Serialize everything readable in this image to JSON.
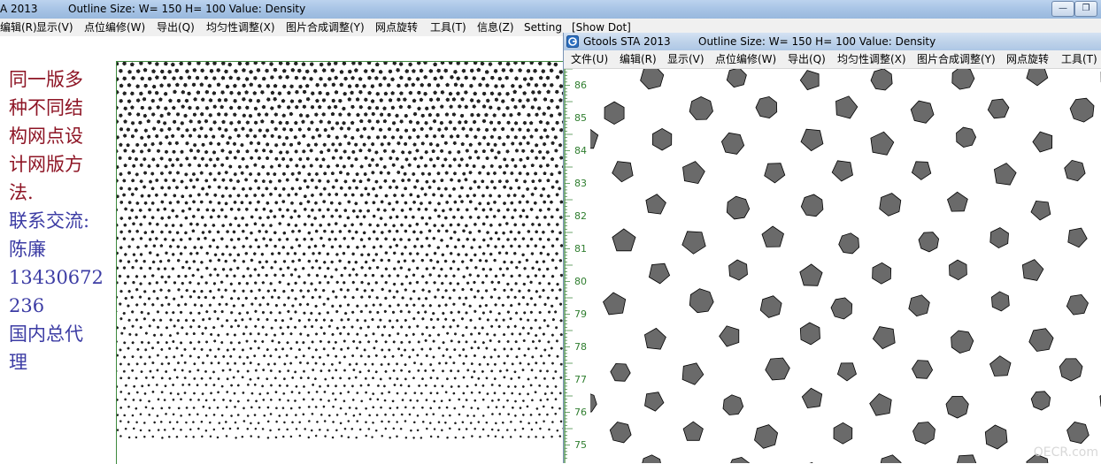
{
  "back_window": {
    "title": "A 2013",
    "title_info": "Outline Size: W= 150  H= 100  Value: Density",
    "buttons": {
      "minimize": "—",
      "restore": "❐"
    },
    "menu": [
      "编辑(R)",
      "显示(V)",
      "点位编修(W)",
      "导出(Q)",
      "均匀性调整(X)",
      "图片合成调整(Y)",
      "网点旋转",
      "工具(T)",
      "信息(Z)",
      "Setting",
      "[Show Dot]"
    ]
  },
  "side_text": {
    "lines_red": [
      "同一版多",
      "种不同结",
      "构网点设",
      "计网版方",
      "法."
    ],
    "lines_blue": [
      "联系交流:",
      "陈廉",
      "13430672",
      "236",
      "国内总代",
      "理"
    ]
  },
  "front_window": {
    "title": "Gtools STA 2013",
    "title_info": "Outline Size: W= 150  H= 100  Value: Density",
    "menu": [
      "文件(U)",
      "编辑(R)",
      "显示(V)",
      "点位编修(W)",
      "导出(Q)",
      "均匀性调整(X)",
      "图片合成调整(Y)",
      "网点旋转",
      "工具(T)"
    ]
  },
  "ruler_labels": [
    "86",
    "85",
    "84",
    "83",
    "82",
    "81",
    "80",
    "79",
    "78",
    "77",
    "76",
    "75"
  ],
  "watermark": "OECR.com",
  "colors": {
    "dot_fill": "#6a6a6a",
    "dot_stroke": "#000000",
    "ruler_green": "#2e7d2e",
    "accent_red": "#8e1525",
    "accent_blue": "#3c3ca4"
  }
}
